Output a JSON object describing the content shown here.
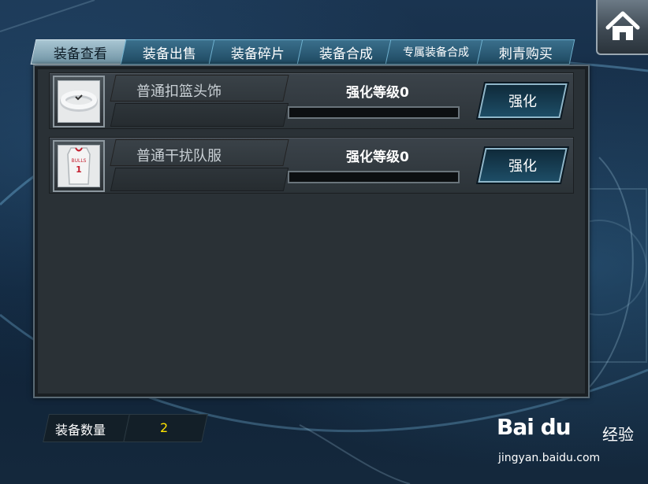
{
  "tabs": [
    {
      "label": "装备查看",
      "active": true
    },
    {
      "label": "装备出售",
      "active": false
    },
    {
      "label": "装备碎片",
      "active": false
    },
    {
      "label": "装备合成",
      "active": false
    },
    {
      "label": "专属装备合成",
      "active": false
    },
    {
      "label": "刺青购买",
      "active": false
    }
  ],
  "items": [
    {
      "name": "普通扣篮头饰",
      "level_label": "强化等级0",
      "progress": 0,
      "button": "强化",
      "icon": "headband-icon"
    },
    {
      "name": "普通干扰队服",
      "level_label": "强化等级0",
      "progress": 0,
      "button": "强化",
      "icon": "jersey-icon"
    }
  ],
  "jersey": {
    "team": "BULLS",
    "number": "1"
  },
  "footer": {
    "count_label": "装备数量",
    "count_value": "2"
  },
  "watermark": {
    "brand": "Bai du",
    "product": "经验",
    "url": "jingyan.baidu.com"
  },
  "colors": {
    "accent": "#3aa5d8",
    "count_value": "#ffe300",
    "active_tab": "#a9c6d3",
    "button_bg": "#1d4d66"
  }
}
